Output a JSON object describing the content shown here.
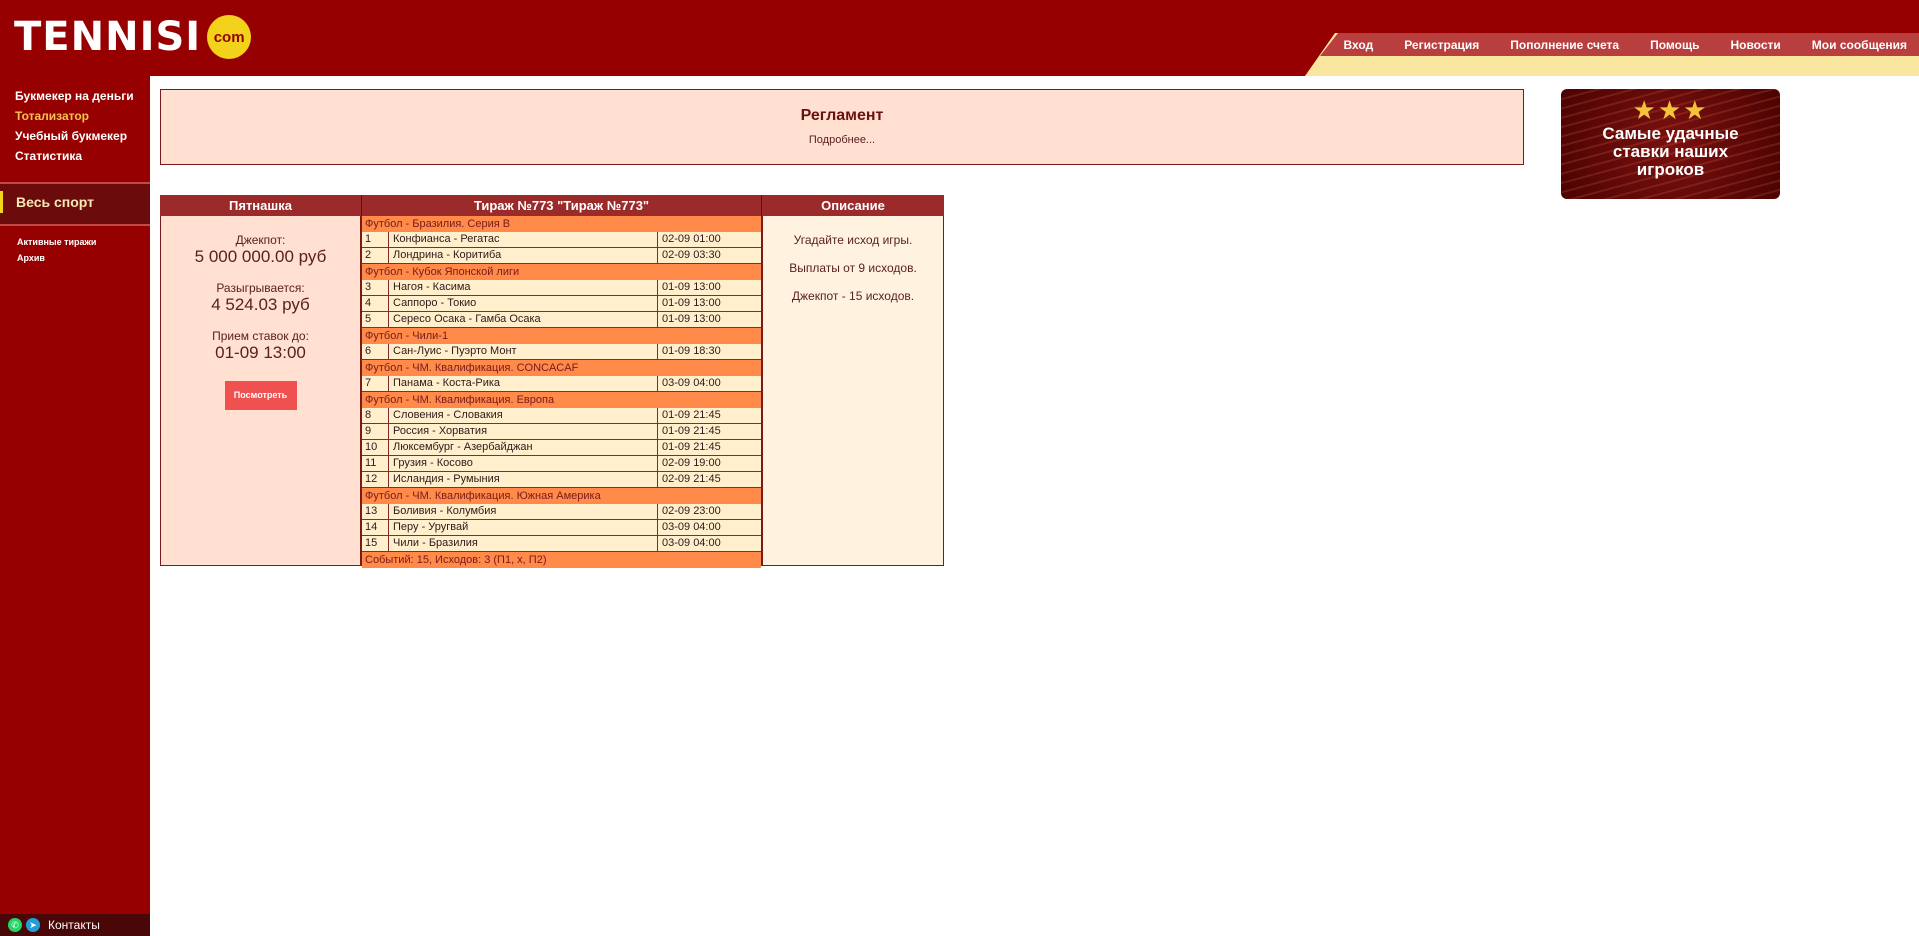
{
  "header": {
    "logo": {
      "text": "TENNISI",
      "badge": "com"
    },
    "nav": [
      "Вход",
      "Регистрация",
      "Пополнение счета",
      "Помощь",
      "Новости",
      "Мои сообщения"
    ]
  },
  "sidebar": {
    "links": [
      {
        "label": "Букмекер на деньги",
        "active": false
      },
      {
        "label": "Тотализатор",
        "active": true
      },
      {
        "label": "Учебный букмекер",
        "active": false
      },
      {
        "label": "Статистика",
        "active": false
      }
    ],
    "sport": "Весь спорт",
    "sub_links": [
      "Активные тиражи",
      "Архив"
    ],
    "contacts": "Контакты"
  },
  "reglament": {
    "title": "Регламент",
    "more": "Подробнее..."
  },
  "banner": {
    "line1": "Самые удачные",
    "line2": "ставки наших",
    "line3": "игроков",
    "stars": "★★★"
  },
  "headers": {
    "left": "Пятнашка",
    "center": "Тираж №773 \"Тираж №773\"",
    "right": "Описание"
  },
  "jackpot": {
    "jackpot_label": "Джекпот:",
    "jackpot_value": "5 000 000.00 руб",
    "drawn_label": "Разыгрывается:",
    "drawn_value": "4 524.03 руб",
    "until_label": "Прием ставок до:",
    "until_value": "01-09 13:00",
    "button": "Посмотреть"
  },
  "description": {
    "line1": "Угадайте исход игры.",
    "line2": "Выплаты от 9 исходов.",
    "line3": "Джекпот - 15 исходов."
  },
  "groups": [
    {
      "name": "Футбол - Бразилия. Серия B",
      "matches": [
        {
          "n": "1",
          "m": "Конфианса - Регатас",
          "d": "02-09 01:00"
        },
        {
          "n": "2",
          "m": "Лондрина - Коритиба",
          "d": "02-09 03:30"
        }
      ]
    },
    {
      "name": "Футбол - Кубок Японской лиги",
      "matches": [
        {
          "n": "3",
          "m": "Нагоя - Касима",
          "d": "01-09 13:00"
        },
        {
          "n": "4",
          "m": "Саппоро - Токио",
          "d": "01-09 13:00"
        },
        {
          "n": "5",
          "m": "Сересо Осака - Гамба Осака",
          "d": "01-09 13:00"
        }
      ]
    },
    {
      "name": "Футбол - Чили-1",
      "matches": [
        {
          "n": "6",
          "m": "Сан-Луис - Пуэрто Монт",
          "d": "01-09 18:30"
        }
      ]
    },
    {
      "name": "Футбол - ЧМ. Квалификация. CONCACAF",
      "matches": [
        {
          "n": "7",
          "m": "Панама - Коста-Рика",
          "d": "03-09 04:00"
        }
      ]
    },
    {
      "name": "Футбол - ЧМ. Квалификация. Европа",
      "matches": [
        {
          "n": "8",
          "m": "Словения - Словакия",
          "d": "01-09 21:45"
        },
        {
          "n": "9",
          "m": "Россия - Хорватия",
          "d": "01-09 21:45"
        },
        {
          "n": "10",
          "m": "Люксембург - Азербайджан",
          "d": "01-09 21:45"
        },
        {
          "n": "11",
          "m": "Грузия - Косово",
          "d": "02-09 19:00"
        },
        {
          "n": "12",
          "m": "Исландия - Румыния",
          "d": "02-09 21:45"
        }
      ]
    },
    {
      "name": "Футбол - ЧМ. Квалификация. Южная Америка",
      "matches": [
        {
          "n": "13",
          "m": "Боливия - Колумбия",
          "d": "02-09 23:00"
        },
        {
          "n": "14",
          "m": "Перу - Уругвай",
          "d": "03-09 04:00"
        },
        {
          "n": "15",
          "m": "Чили - Бразилия",
          "d": "03-09 04:00"
        }
      ]
    }
  ],
  "footer": "Событий: 15, Исходов: 3 (П1, х, П2)"
}
